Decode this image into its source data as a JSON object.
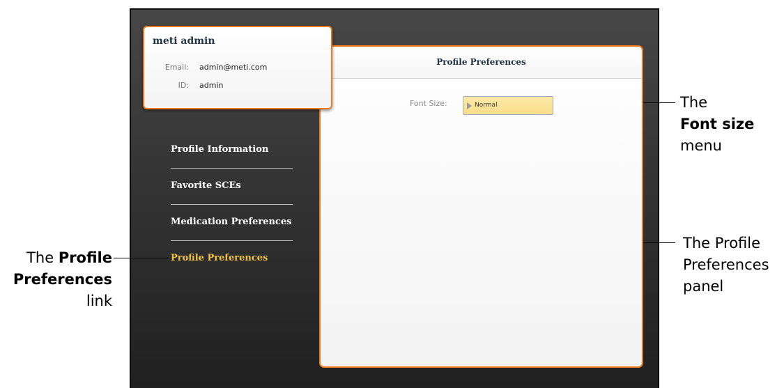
{
  "user_card": {
    "name": "meti admin",
    "email_label": "Email:",
    "email_value": "admin@meti.com",
    "id_label": "ID:",
    "id_value": "admin"
  },
  "sidebar": {
    "items": [
      {
        "label": "Profile Information",
        "active": false
      },
      {
        "label": "Favorite SCEs",
        "active": false
      },
      {
        "label": "Medication Preferences",
        "active": false
      },
      {
        "label": "Profile Preferences",
        "active": true
      }
    ]
  },
  "panel": {
    "title": "Profile Preferences",
    "font_size_label": "Font Size:",
    "font_size_value": "Normal"
  },
  "callouts": {
    "font_size_menu": {
      "part1": "The",
      "part2": "Font size",
      "part3": "menu"
    },
    "profile_link": {
      "part1": "The ",
      "part2": "Profile",
      "part3": "Preferences",
      "part4": "link"
    },
    "panel": {
      "part1": "The Profile",
      "part2": "Preferences",
      "part3": "panel"
    }
  },
  "colors": {
    "accent_orange": "#ee7a1c",
    "active_link": "#f4c23f",
    "select_bg": "#f9de8c",
    "title_navy": "#1f3346"
  }
}
